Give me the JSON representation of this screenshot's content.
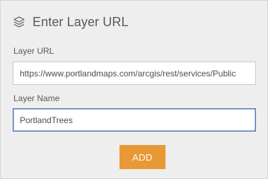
{
  "header": {
    "icon": "layers-icon",
    "title": "Enter Layer URL"
  },
  "layer_url": {
    "label": "Layer URL",
    "value": "https://www.portlandmaps.com/arcgis/rest/services/Public"
  },
  "layer_name": {
    "label": "Layer Name",
    "value": "PortlandTrees"
  },
  "add_button": {
    "label": "ADD",
    "color": "#e89834"
  },
  "colors": {
    "panel_background": "#eeeeee",
    "text": "#595959",
    "focus_border": "#4a7ab7"
  }
}
